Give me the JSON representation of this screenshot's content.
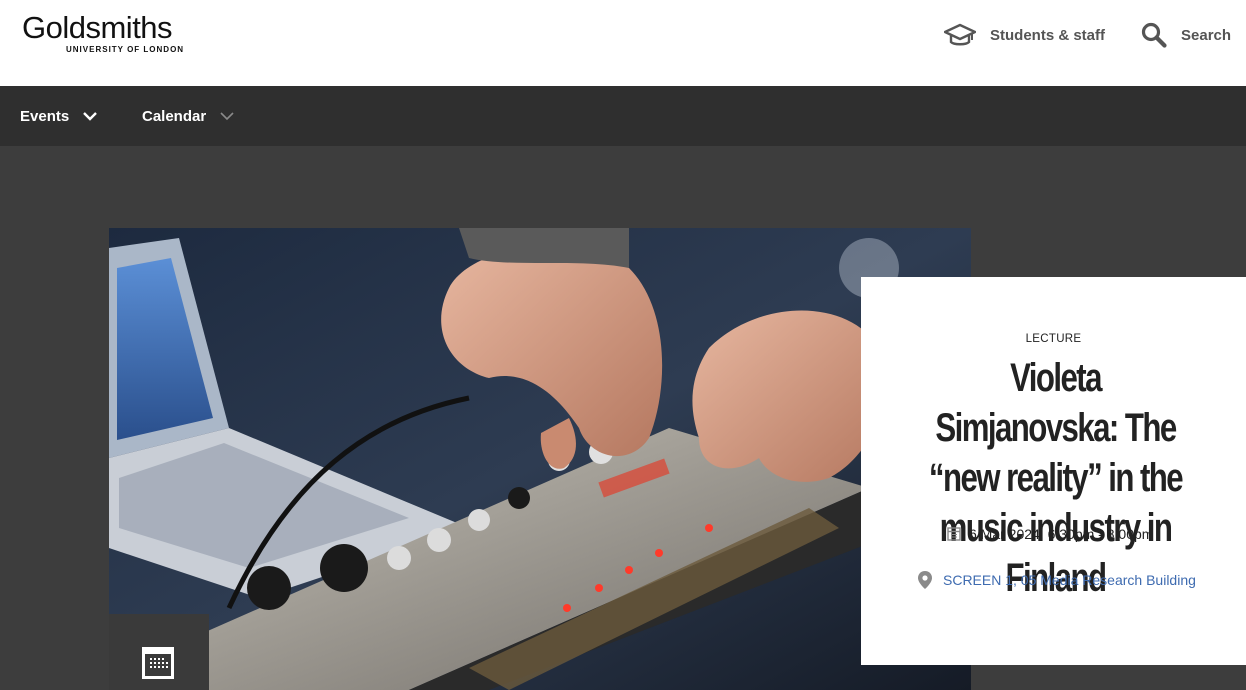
{
  "header": {
    "logo_main": "Goldsmiths",
    "logo_sub": "UNIVERSITY OF LONDON",
    "students_link": "Students & staff",
    "search_link": "Search"
  },
  "nav": {
    "events": "Events",
    "calendar": "Calendar"
  },
  "event": {
    "type": "LECTURE",
    "title": "Violeta Simjanovska: The “new reality” in the music industry in Finland",
    "datetime": "6 Mar 2024, 6:30pm - 8:00pm",
    "location": "SCREEN 1, 05 Media Research Building"
  },
  "icons": {
    "students": "graduation-cap-icon",
    "search": "magnifier-icon",
    "nav_chevron": "chevron-down-icon",
    "date": "calendar-icon",
    "location": "map-pin-icon",
    "add_to_calendar": "calendar-grid-icon"
  },
  "colors": {
    "header_bg": "#ffffff",
    "nav_bg": "#2f2f2f",
    "page_bg": "#3d3d3d",
    "link": "#3e6bb0"
  }
}
